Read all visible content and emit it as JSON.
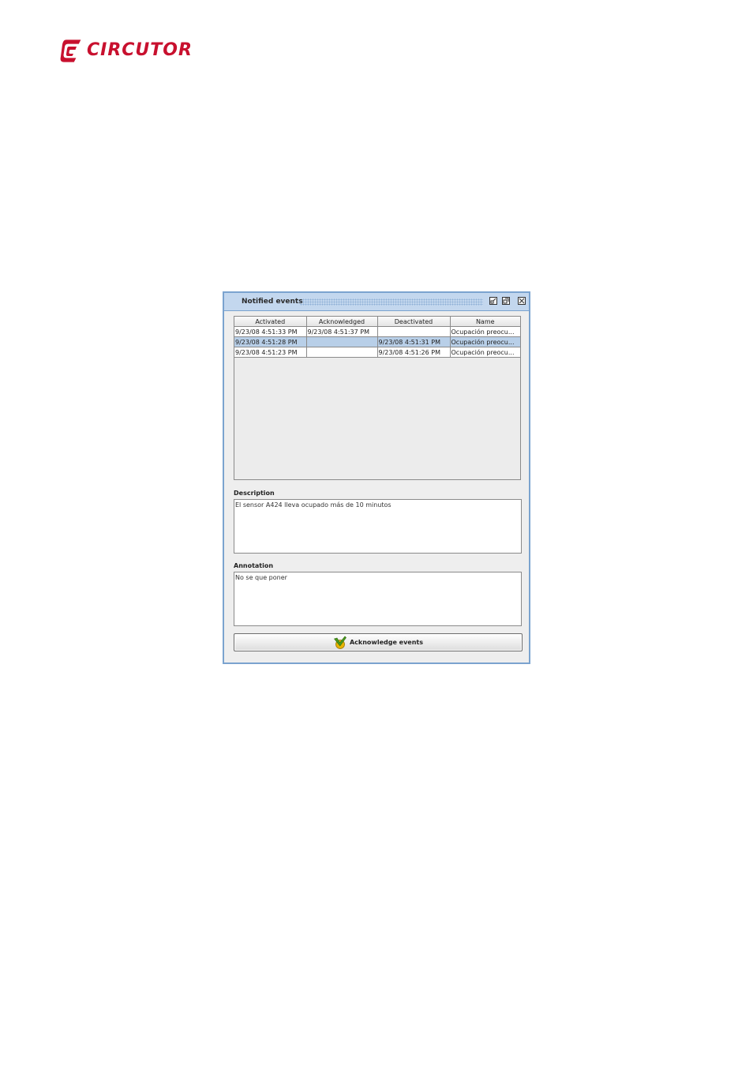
{
  "logo": {
    "text": "CIRCUTOR",
    "brand_color": "#c8102e"
  },
  "window": {
    "title": "Notified events",
    "controls": [
      "iconify-icon",
      "maximize-icon",
      "close-icon"
    ],
    "accent_color": "#7ba3cf"
  },
  "table": {
    "columns": [
      "Activated",
      "Acknowledged",
      "Deactivated",
      "Name"
    ],
    "rows": [
      [
        "9/23/08 4:51:33 PM",
        "9/23/08 4:51:37 PM",
        "",
        "Ocupación preocu..."
      ],
      [
        "9/23/08 4:51:28 PM",
        "",
        "9/23/08 4:51:31 PM",
        "Ocupación preocu..."
      ],
      [
        "9/23/08 4:51:23 PM",
        "",
        "9/23/08 4:51:26 PM",
        "Ocupación preocu..."
      ]
    ],
    "selected_row": 1,
    "selection_color": "#b8cfe8"
  },
  "description": {
    "label": "Description",
    "value": "El sensor A424 lleva ocupado más de 10 minutos"
  },
  "annotation": {
    "label": "Annotation",
    "value": "No se que poner"
  },
  "actions": {
    "acknowledge_label": "Acknowledge events",
    "acknowledge_icon": "checkmark-icon"
  }
}
